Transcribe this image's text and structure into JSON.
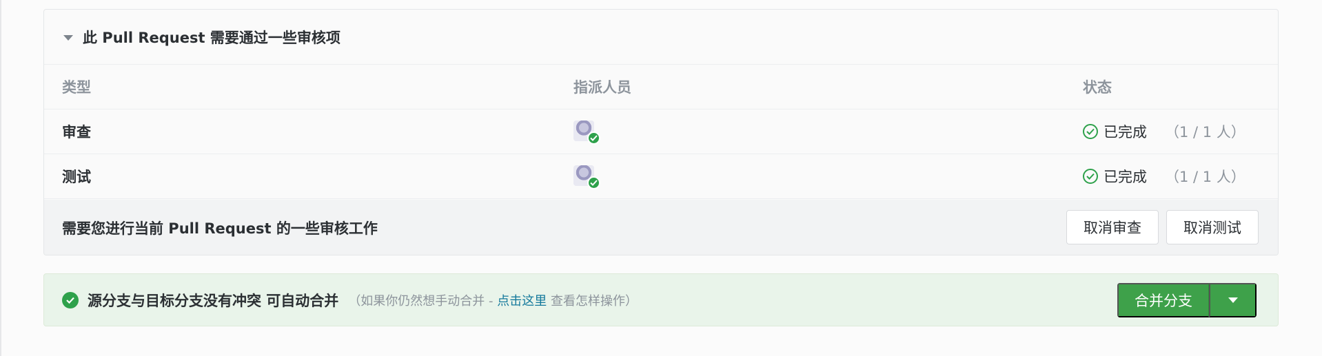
{
  "colors": {
    "success_green": "#2ea14b",
    "merge_button_green": "#3ea14a",
    "link_blue": "#14799c",
    "merge_panel_bg": "#e9f4ea"
  },
  "review_panel": {
    "title": "此 Pull Request 需要通过一些审核项",
    "collapse_icon": "caret-down-icon",
    "columns": {
      "type": "类型",
      "assignee": "指派人员",
      "status": "状态"
    },
    "rows": [
      {
        "type": "审查",
        "assignee_avatar": "avatar",
        "status": "已完成",
        "count": "（1 / 1 人）"
      },
      {
        "type": "测试",
        "assignee_avatar": "avatar",
        "status": "已完成",
        "count": "（1 / 1 人）"
      }
    ],
    "footer": {
      "text": "需要您进行当前 Pull Request 的一些审核工作",
      "cancel_review_label": "取消审查",
      "cancel_test_label": "取消测试"
    }
  },
  "merge_panel": {
    "icon": "check-circle-icon",
    "title": "源分支与目标分支没有冲突 可自动合并",
    "hint_before": "（如果你仍然想手动合并 - ",
    "hint_link": "点击这里",
    "hint_after": " 查看怎样操作）",
    "merge_button_label": "合并分支",
    "dropdown_icon": "caret-down-icon"
  }
}
